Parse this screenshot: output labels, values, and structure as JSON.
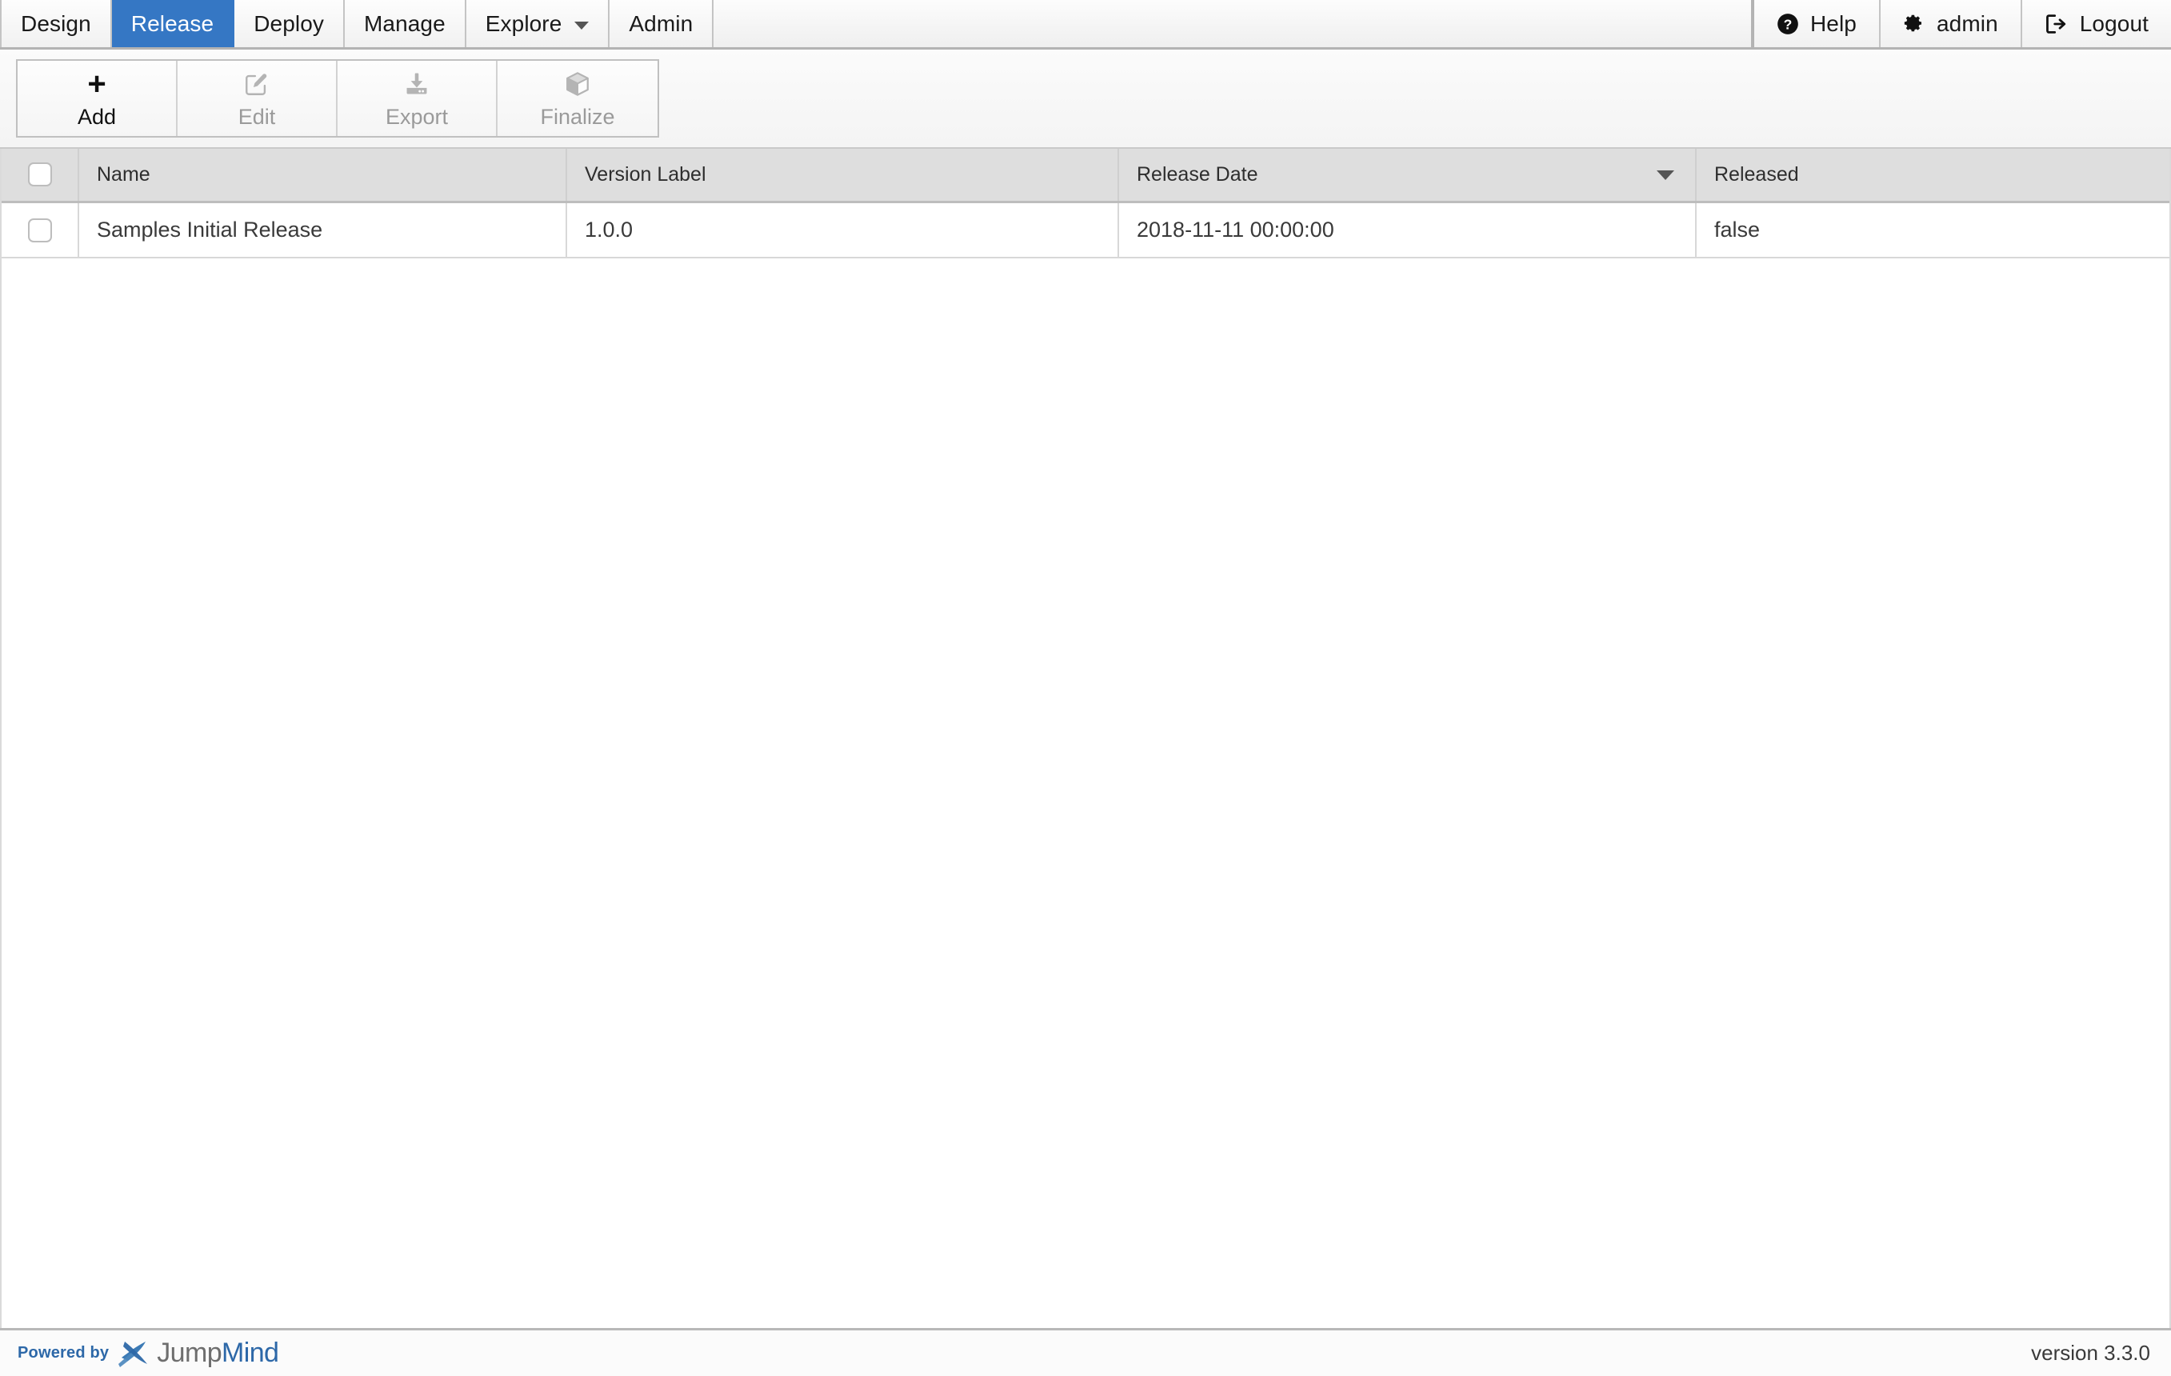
{
  "topnav": {
    "items": [
      {
        "label": "Design",
        "name": "tab-design",
        "selected": false,
        "caret": false
      },
      {
        "label": "Release",
        "name": "tab-release",
        "selected": true,
        "caret": false
      },
      {
        "label": "Deploy",
        "name": "tab-deploy",
        "selected": false,
        "caret": false
      },
      {
        "label": "Manage",
        "name": "tab-manage",
        "selected": false,
        "caret": false
      },
      {
        "label": "Explore",
        "name": "tab-explore",
        "selected": false,
        "caret": true
      },
      {
        "label": "Admin",
        "name": "tab-admin",
        "selected": false,
        "caret": false
      }
    ],
    "right": [
      {
        "label": "Help",
        "icon": "help-circle-icon",
        "name": "help-button"
      },
      {
        "label": "admin",
        "icon": "gear-icon",
        "name": "user-admin-button"
      },
      {
        "label": "Logout",
        "icon": "logout-icon",
        "name": "logout-button"
      }
    ],
    "selected_color": "#3577c4"
  },
  "toolbar": {
    "buttons": [
      {
        "label": "Add",
        "icon": "plus-icon",
        "name": "add-button",
        "enabled": true
      },
      {
        "label": "Edit",
        "icon": "pencil-square-icon",
        "name": "edit-button",
        "enabled": false
      },
      {
        "label": "Export",
        "icon": "download-tray-icon",
        "name": "export-button",
        "enabled": false
      },
      {
        "label": "Finalize",
        "icon": "cube-icon",
        "name": "finalize-button",
        "enabled": false
      }
    ]
  },
  "grid": {
    "columns": [
      {
        "label": "",
        "key": "check",
        "name": "column-select-all",
        "sorted": "none"
      },
      {
        "label": "Name",
        "key": "name",
        "name": "column-name",
        "sorted": "none"
      },
      {
        "label": "Version Label",
        "key": "version_label",
        "name": "column-version-label",
        "sorted": "none"
      },
      {
        "label": "Release Date",
        "key": "release_date",
        "name": "column-release-date",
        "sorted": "desc"
      },
      {
        "label": "Released",
        "key": "released",
        "name": "column-released",
        "sorted": "none"
      }
    ],
    "rows": [
      {
        "selected": false,
        "name": "Samples Initial Release",
        "version_label": "1.0.0",
        "release_date": "2018-11-11 00:00:00",
        "released": "false"
      }
    ]
  },
  "footer": {
    "brand_prefix": "Powered by",
    "brand_jump": "Jump",
    "brand_m": "M",
    "brand_ind": "ind",
    "version": "version 3.3.0",
    "brand_color": "#2d68a8"
  }
}
